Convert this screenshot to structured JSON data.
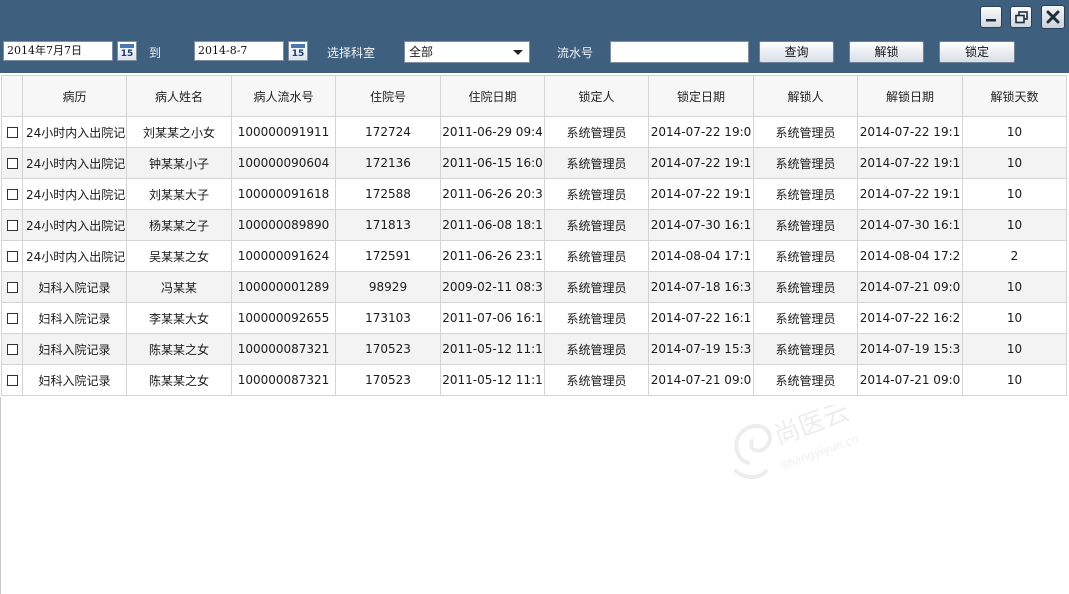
{
  "window": {
    "controls": [
      "minimize-icon",
      "restore-icon",
      "close-icon"
    ],
    "accent": "#3f5f7f"
  },
  "filters": {
    "start_date": "2014年7月7日",
    "to_label": "到",
    "end_date": "2014-8-7",
    "calendar_day": "15",
    "dept_label": "选择科室",
    "dept_value": "全部",
    "serial_label": "流水号",
    "serial_value": ""
  },
  "buttons": {
    "query": "查询",
    "unlock": "解锁",
    "lock": "锁定"
  },
  "table": {
    "columns": [
      "病历",
      "病人姓名",
      "病人流水号",
      "住院号",
      "住院日期",
      "锁定人",
      "锁定日期",
      "解锁人",
      "解锁日期",
      "解锁天数"
    ],
    "rows": [
      [
        "24小时内入出院记",
        "刘某某之小女",
        "100000091911",
        "172724",
        "2011-06-29 09:4",
        "系统管理员",
        "2014-07-22 19:0",
        "系统管理员",
        "2014-07-22 19:1",
        "10"
      ],
      [
        "24小时内入出院记",
        "钟某某小子",
        "100000090604",
        "172136",
        "2011-06-15 16:0",
        "系统管理员",
        "2014-07-22 19:1",
        "系统管理员",
        "2014-07-22 19:1",
        "10"
      ],
      [
        "24小时内入出院记",
        "刘某某大子",
        "100000091618",
        "172588",
        "2011-06-26 20:3",
        "系统管理员",
        "2014-07-22 19:1",
        "系统管理员",
        "2014-07-22 19:1",
        "10"
      ],
      [
        "24小时内入出院记",
        "杨某某之子",
        "100000089890",
        "171813",
        "2011-06-08 18:1",
        "系统管理员",
        "2014-07-30 16:1",
        "系统管理员",
        "2014-07-30 16:1",
        "10"
      ],
      [
        "24小时内入出院记",
        "吴某某之女",
        "100000091624",
        "172591",
        "2011-06-26 23:1",
        "系统管理员",
        "2014-08-04 17:1",
        "系统管理员",
        "2014-08-04 17:2",
        "2"
      ],
      [
        "妇科入院记录",
        "冯某某",
        "100000001289",
        "98929",
        "2009-02-11 08:3",
        "系统管理员",
        "2014-07-18 16:3",
        "系统管理员",
        "2014-07-21 09:0",
        "10"
      ],
      [
        "妇科入院记录",
        "李某某大女",
        "100000092655",
        "173103",
        "2011-07-06 16:1",
        "系统管理员",
        "2014-07-22 16:1",
        "系统管理员",
        "2014-07-22 16:2",
        "10"
      ],
      [
        "妇科入院记录",
        "陈某某之女",
        "100000087321",
        "170523",
        "2011-05-12 11:1",
        "系统管理员",
        "2014-07-19 15:3",
        "系统管理员",
        "2014-07-19 15:3",
        "10"
      ],
      [
        "妇科入院记录",
        "陈某某之女",
        "100000087321",
        "170523",
        "2011-05-12 11:1",
        "系统管理员",
        "2014-07-21 09:0",
        "系统管理员",
        "2014-07-21 09:0",
        "10"
      ]
    ]
  },
  "watermark": {
    "text": "尚医云",
    "sub": "shangyiyun.cn"
  }
}
